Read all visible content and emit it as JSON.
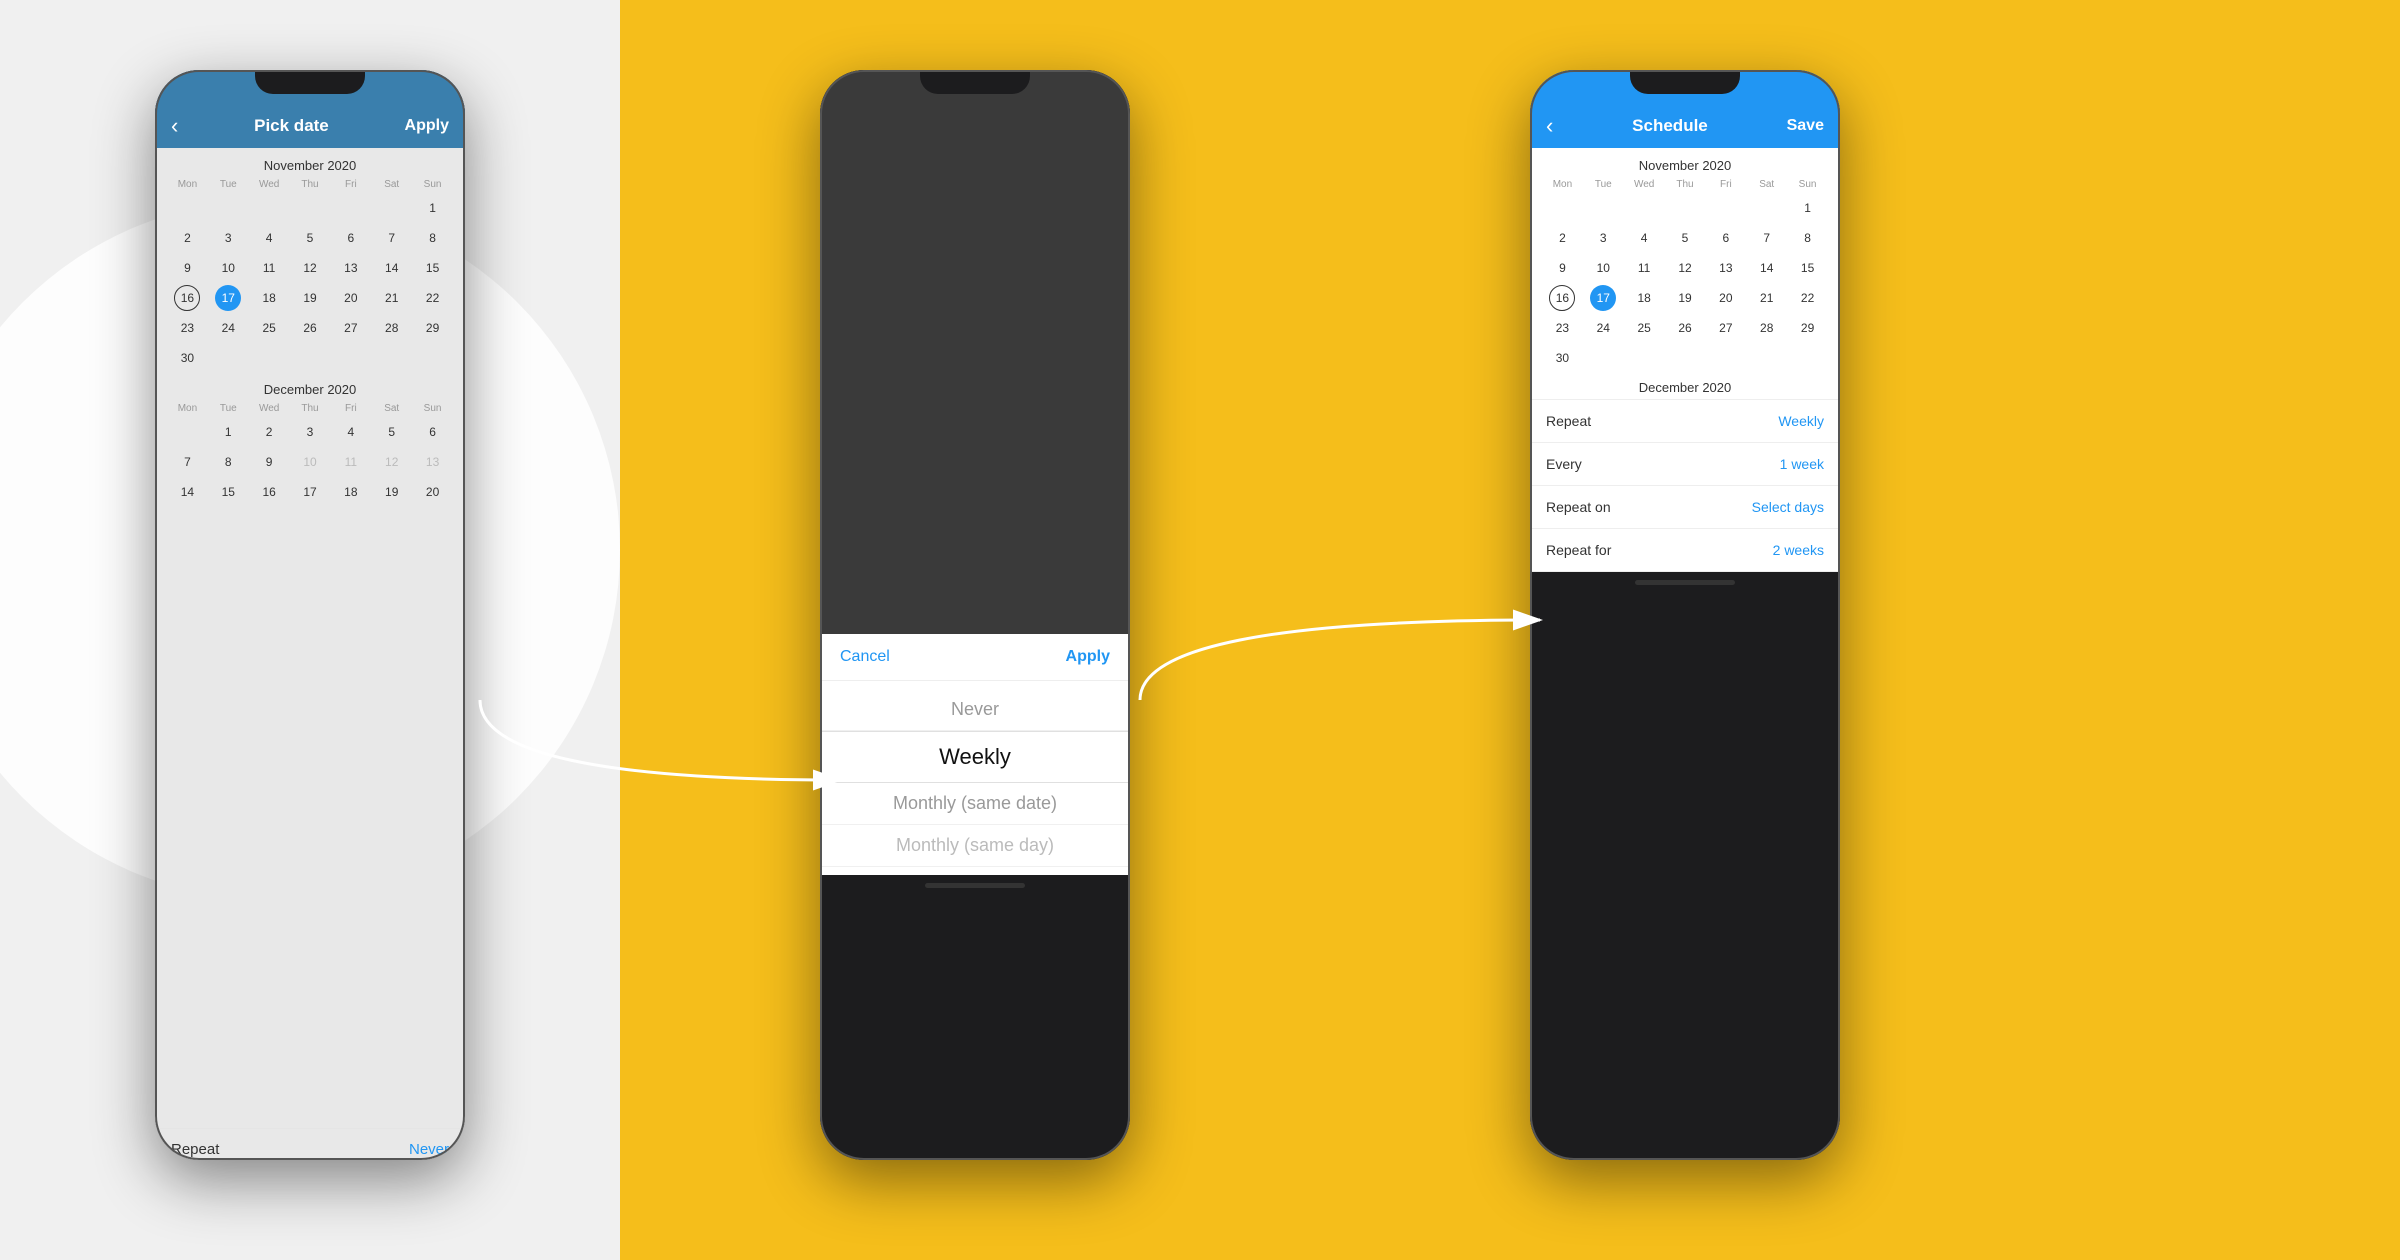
{
  "background": {
    "left_color": "#f0f0f0",
    "right_color": "#F5BE1B"
  },
  "phone1": {
    "header": {
      "back_label": "‹",
      "title": "Pick date",
      "action": "Apply"
    },
    "november": {
      "title": "November 2020",
      "weekdays": [
        "Mon",
        "Tue",
        "Wed",
        "Thu",
        "Fri",
        "Sat",
        "Sun"
      ],
      "weeks": [
        [
          "",
          "",
          "",
          "",
          "",
          "",
          "1"
        ],
        [
          "2",
          "3",
          "4",
          "5",
          "6",
          "7",
          "8"
        ],
        [
          "9",
          "10",
          "11",
          "12",
          "13",
          "14",
          "15"
        ],
        [
          "16",
          "17",
          "18",
          "19",
          "20",
          "21",
          "22"
        ],
        [
          "23",
          "24",
          "25",
          "26",
          "27",
          "28",
          "29"
        ],
        [
          "30",
          "",
          "",
          "",
          "",
          "",
          ""
        ]
      ],
      "today_cell": "16",
      "selected_cell": "17"
    },
    "december": {
      "title": "December 2020",
      "weekdays": [
        "Mon",
        "Tue",
        "Wed",
        "Thu",
        "Fri",
        "Sat",
        "Sun"
      ],
      "weeks": [
        [
          "",
          "1",
          "2",
          "3",
          "4",
          "5",
          "6"
        ],
        [
          "7",
          "8",
          "9",
          "10",
          "11",
          "12",
          "13"
        ],
        [
          "14",
          "15",
          "16",
          "17",
          "18",
          "19",
          "20"
        ]
      ]
    },
    "bottom": {
      "label": "Repeat",
      "value": "Never"
    }
  },
  "phone2": {
    "picker": {
      "cancel_label": "Cancel",
      "apply_label": "Apply",
      "options": [
        {
          "label": "Never",
          "state": "normal"
        },
        {
          "label": "Weekly",
          "state": "selected"
        },
        {
          "label": "Monthly (same date)",
          "state": "normal"
        },
        {
          "label": "Monthly (same day)",
          "state": "grayed"
        }
      ]
    }
  },
  "phone3": {
    "header": {
      "back_label": "‹",
      "title": "Schedule",
      "action": "Save"
    },
    "november": {
      "title": "November 2020",
      "weekdays": [
        "Mon",
        "Tue",
        "Wed",
        "Thu",
        "Fri",
        "Sat",
        "Sun"
      ],
      "weeks": [
        [
          "",
          "",
          "",
          "",
          "",
          "",
          "1"
        ],
        [
          "2",
          "3",
          "4",
          "5",
          "6",
          "7",
          "8"
        ],
        [
          "9",
          "10",
          "11",
          "12",
          "13",
          "14",
          "15"
        ],
        [
          "16",
          "17",
          "18",
          "19",
          "20",
          "21",
          "22"
        ],
        [
          "23",
          "24",
          "25",
          "26",
          "27",
          "28",
          "29"
        ],
        [
          "30",
          "",
          "",
          "",
          "",
          "",
          ""
        ]
      ],
      "today_cell": "16",
      "selected_cell": "17"
    },
    "december": {
      "title": "December 2020"
    },
    "schedule_rows": [
      {
        "label": "Repeat",
        "value": "Weekly"
      },
      {
        "label": "Every",
        "value": "1 week"
      },
      {
        "label": "Repeat on",
        "value": "Select days"
      },
      {
        "label": "Repeat for",
        "value": "2 weeks"
      }
    ]
  }
}
